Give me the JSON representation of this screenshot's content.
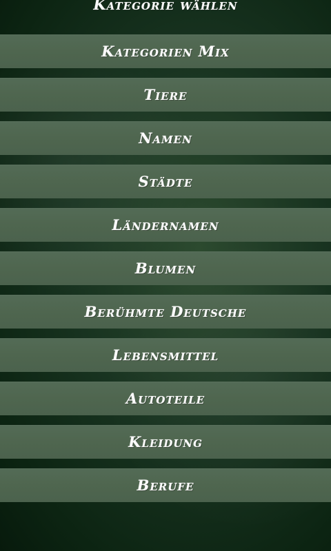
{
  "header": {
    "title": "Kategorie wählen"
  },
  "categories": [
    {
      "label": "Kategorien Mix"
    },
    {
      "label": "Tiere"
    },
    {
      "label": "Namen"
    },
    {
      "label": "Städte"
    },
    {
      "label": "Ländernamen"
    },
    {
      "label": "Blumen"
    },
    {
      "label": "Berühmte Deutsche"
    },
    {
      "label": "Lebensmittel"
    },
    {
      "label": "Autoteile"
    },
    {
      "label": "Kleidung"
    },
    {
      "label": "Berufe"
    }
  ]
}
